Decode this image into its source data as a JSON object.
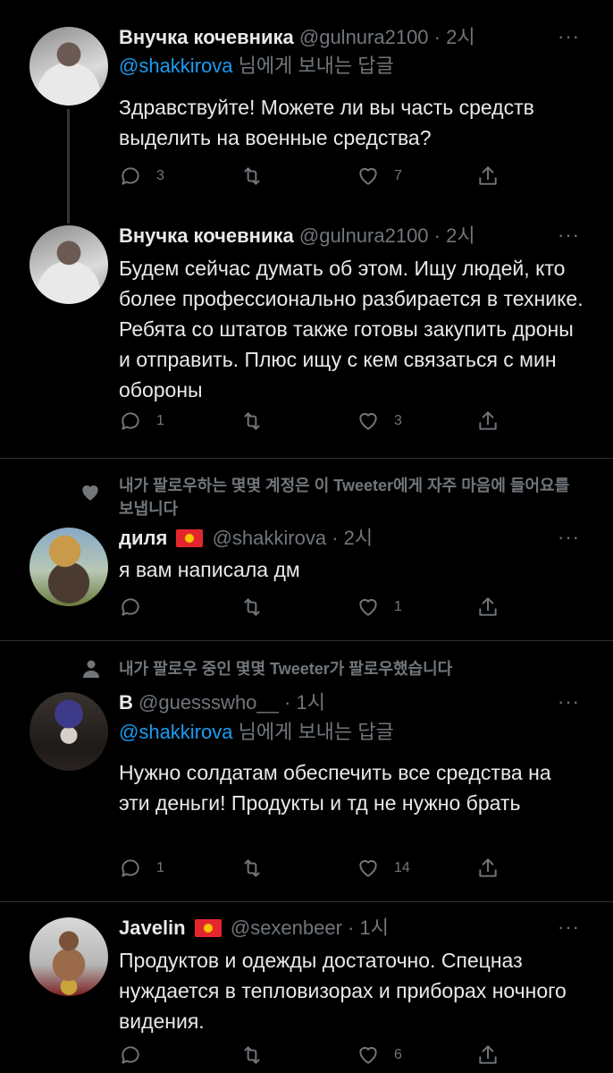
{
  "tweets": [
    {
      "name": "Внучка кочевника",
      "handle": "@gulnura2100",
      "time": "2시",
      "reply_to": "@shakkirova",
      "reply_suffix": " 님에게 보내는 답글",
      "text": "Здравствуйте! Можете ли вы часть средств выделить на военные средства?",
      "replies": "3",
      "retweets": "",
      "likes": "7"
    },
    {
      "name": "Внучка кочевника",
      "handle": "@gulnura2100",
      "time": "2시",
      "text": "Будем сейчас думать об этом. Ищу людей, кто более профессионально разбирается в технике. Ребята со штатов также готовы закупить дроны и отправить. Плюс ищу с кем связаться с мин обороны",
      "replies": "1",
      "retweets": "",
      "likes": "3"
    },
    {
      "social_context": "내가 팔로우하는 몇몇 계정은 이 Tweeter에게 자주 마음에 들어요를 보냅니다",
      "name": "диля",
      "handle": "@shakkirova",
      "time": "2시",
      "text": "я вам написала дм",
      "replies": "",
      "retweets": "",
      "likes": "1"
    },
    {
      "social_context": "내가 팔로우 중인 몇몇 Tweeter가 팔로우했습니다",
      "name": "B",
      "handle": "@guessswho__",
      "time": "1시",
      "reply_to": "@shakkirova",
      "reply_suffix": " 님에게 보내는 답글",
      "text": "Нужно солдатам обеспечить все средства на эти деньги! Продукты и тд не нужно брать",
      "replies": "1",
      "retweets": "",
      "likes": "14"
    },
    {
      "name": "Javelin",
      "handle": "@sexenbeer",
      "time": "1시",
      "text": "Продуктов и одежды достаточно. Спецназ нуждается в тепловизорах и приборах ночного видения.",
      "replies": "",
      "retweets": "",
      "likes": "6"
    }
  ],
  "separator": " · ",
  "more_icon": "···",
  "colors": {
    "background": "#000000",
    "text": "#e7e9ea",
    "muted": "#71767b",
    "link": "#1d9bf0"
  }
}
